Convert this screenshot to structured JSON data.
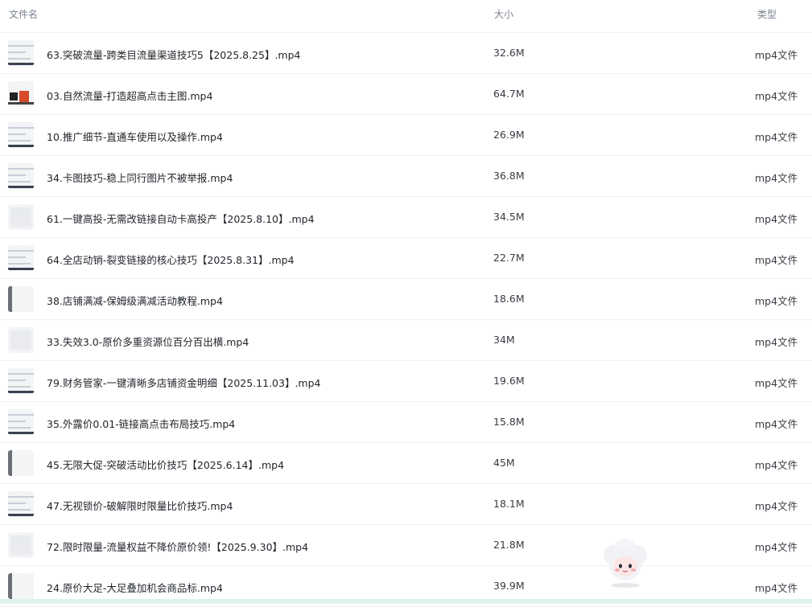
{
  "header": {
    "name": "文件名",
    "size": "大小",
    "type": "类型"
  },
  "files": [
    {
      "name": "63.突破流量-跨类目流量渠道技巧5【2025.8.25】.mp4",
      "size": "32.6M",
      "type": "mp4文件",
      "thumb": "light"
    },
    {
      "name": "03.自然流量-打造超高点击主图.mp4",
      "size": "64.7M",
      "type": "mp4文件",
      "thumb": "red"
    },
    {
      "name": "10.推广细节-直通车使用以及操作.mp4",
      "size": "26.9M",
      "type": "mp4文件",
      "thumb": "light"
    },
    {
      "name": "34.卡图技巧-稳上同行图片不被举报.mp4",
      "size": "36.8M",
      "type": "mp4文件",
      "thumb": "light"
    },
    {
      "name": "61.一键高投-无需改链接自动卡高投产【2025.8.10】.mp4",
      "size": "34.5M",
      "type": "mp4文件",
      "thumb": "dark"
    },
    {
      "name": "64.全店动销-裂变链接的核心技巧【2025.8.31】.mp4",
      "size": "22.7M",
      "type": "mp4文件",
      "thumb": "light"
    },
    {
      "name": "38.店铺满减-保姆级满减活动教程.mp4",
      "size": "18.6M",
      "type": "mp4文件",
      "thumb": "side"
    },
    {
      "name": "33.失效3.0-原价多重资源位百分百出横.mp4",
      "size": "34M",
      "type": "mp4文件",
      "thumb": "dark"
    },
    {
      "name": "79.财务管家-一键清晰多店铺资金明细【2025.11.03】.mp4",
      "size": "19.6M",
      "type": "mp4文件",
      "thumb": "light"
    },
    {
      "name": "35.外露价0.01-链接高点击布局技巧.mp4",
      "size": "15.8M",
      "type": "mp4文件",
      "thumb": "light"
    },
    {
      "name": "45.无限大促-突破活动比价技巧【2025.6.14】.mp4",
      "size": "45M",
      "type": "mp4文件",
      "thumb": "side"
    },
    {
      "name": "47.无视锁价-破解限时限量比价技巧.mp4",
      "size": "18.1M",
      "type": "mp4文件",
      "thumb": "light"
    },
    {
      "name": "72.限时限量-流量权益不降价原价领!【2025.9.30】.mp4",
      "size": "21.8M",
      "type": "mp4文件",
      "thumb": "dark"
    },
    {
      "name": "24.原价大足-大足叠加机会商品标.mp4",
      "size": "39.9M",
      "type": "mp4文件",
      "thumb": "side"
    }
  ],
  "colors": {
    "divider": "#eef0f3",
    "header_text": "#7a8190",
    "text": "#1f2329",
    "bottom_strip": "#dff3ee"
  },
  "icons": {
    "assistant": "cloud-mascot-icon"
  }
}
